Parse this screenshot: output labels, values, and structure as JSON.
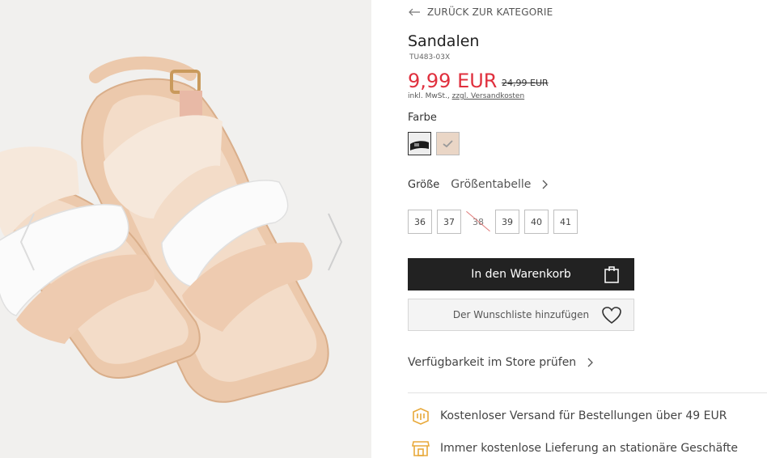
{
  "back_link": {
    "label": "ZURÜCK ZUR KATEGORIE"
  },
  "product": {
    "title": "Sandalen",
    "sku": "TU483-03X",
    "price": "9,99 EUR",
    "old_price": "24,99 EUR",
    "tax_note": "inkl. MwSt.,",
    "shipping_link": "zzgl. Versandkosten"
  },
  "color": {
    "label": "Farbe",
    "options": [
      {
        "name": "black"
      },
      {
        "name": "nude",
        "selected": true
      }
    ]
  },
  "size": {
    "label": "Größe",
    "chart_link": "Größentabelle",
    "options": [
      "36",
      "37",
      "38",
      "39",
      "40",
      "41"
    ],
    "unavailable": [
      "38"
    ]
  },
  "actions": {
    "add_to_cart": "In den Warenkorb",
    "add_to_wishlist": "Der Wunschliste hinzufügen"
  },
  "store_check": {
    "label": "Verfügbarkeit im Store prüfen"
  },
  "benefits": [
    {
      "icon": "package-icon",
      "text": "Kostenloser Versand für Bestellungen über 49 EUR"
    },
    {
      "icon": "store-icon",
      "text": "Immer kostenlose Lieferung an stationäre Geschäfte"
    }
  ],
  "colors": {
    "price": "#e0303e",
    "accent_icon": "#e8a93a",
    "button_dark": "#222222"
  }
}
